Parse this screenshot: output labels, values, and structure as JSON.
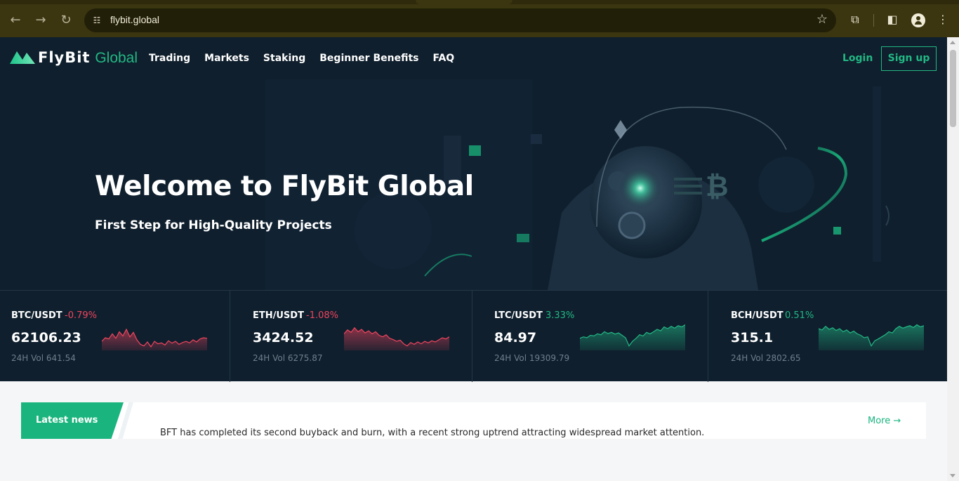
{
  "browser": {
    "url": "flybit.global",
    "back_icon": "arrow-left-icon",
    "forward_icon": "arrow-right-icon",
    "reload_icon": "reload-icon"
  },
  "header": {
    "logo_fly": "FlyBit",
    "logo_global": "Global",
    "nav": [
      "Trading",
      "Markets",
      "Staking",
      "Beginner Benefits",
      "FAQ"
    ],
    "login": "Login",
    "signup": "Sign up"
  },
  "hero": {
    "title": "Welcome to FlyBit Global",
    "subtitle": "First Step for High-Quality Projects"
  },
  "tickers": [
    {
      "pair": "BTC/USDT",
      "change": "-0.79%",
      "price": "62106.23",
      "vol": "24H Vol 641.54",
      "trend": "down",
      "spark": [
        0.3,
        0.42,
        0.38,
        0.55,
        0.4,
        0.62,
        0.48,
        0.7,
        0.45,
        0.6,
        0.35,
        0.2,
        0.15,
        0.28,
        0.12,
        0.3,
        0.22,
        0.25,
        0.18,
        0.32,
        0.24,
        0.3,
        0.2,
        0.26,
        0.3,
        0.25,
        0.35,
        0.28,
        0.38,
        0.42,
        0.4
      ]
    },
    {
      "pair": "ETH/USDT",
      "change": "-1.08%",
      "price": "3424.52",
      "vol": "24H Vol 6275.87",
      "trend": "down",
      "spark": [
        0.55,
        0.68,
        0.6,
        0.75,
        0.62,
        0.7,
        0.58,
        0.65,
        0.55,
        0.62,
        0.5,
        0.45,
        0.52,
        0.4,
        0.36,
        0.3,
        0.34,
        0.22,
        0.15,
        0.26,
        0.2,
        0.28,
        0.22,
        0.3,
        0.25,
        0.32,
        0.28,
        0.35,
        0.42,
        0.38,
        0.45
      ]
    },
    {
      "pair": "LTC/USDT",
      "change": "3.33%",
      "price": "84.97",
      "vol": "24H Vol 19309.79",
      "trend": "up",
      "spark": [
        0.4,
        0.45,
        0.42,
        0.5,
        0.48,
        0.55,
        0.52,
        0.62,
        0.56,
        0.6,
        0.54,
        0.58,
        0.5,
        0.42,
        0.15,
        0.3,
        0.4,
        0.52,
        0.48,
        0.6,
        0.55,
        0.62,
        0.7,
        0.65,
        0.78,
        0.72,
        0.8,
        0.74,
        0.82,
        0.78,
        0.85
      ]
    },
    {
      "pair": "BCH/USDT",
      "change": "0.51%",
      "price": "315.1",
      "vol": "24H Vol 2802.65",
      "trend": "up",
      "spark": [
        0.72,
        0.68,
        0.8,
        0.7,
        0.75,
        0.66,
        0.72,
        0.62,
        0.68,
        0.58,
        0.64,
        0.55,
        0.5,
        0.42,
        0.45,
        0.15,
        0.32,
        0.38,
        0.45,
        0.52,
        0.62,
        0.58,
        0.72,
        0.8,
        0.74,
        0.78,
        0.82,
        0.76,
        0.85,
        0.78,
        0.82
      ]
    }
  ],
  "news": {
    "label": "Latest news",
    "headline": "BFT has completed its second buyback and burn, with a recent strong uptrend attracting widespread market attention.",
    "more": "More →"
  },
  "colors": {
    "brand": "#22b884",
    "down": "#f0445e",
    "up": "#22b884",
    "hero_bg": "#0f1f2d"
  }
}
